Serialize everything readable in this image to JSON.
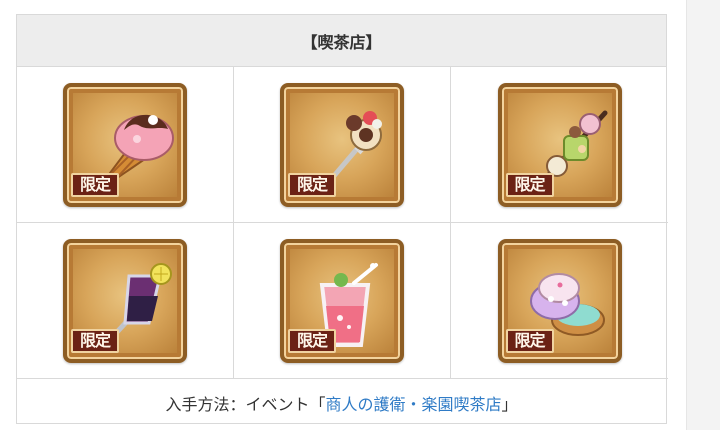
{
  "table": {
    "title": "【喫茶店】",
    "badge_label": "限定",
    "items": [
      {
        "icon": "ice-cream-cone-icon"
      },
      {
        "icon": "fork-with-dessert-icon"
      },
      {
        "icon": "skewer-sweets-icon"
      },
      {
        "icon": "fruit-parfait-icon"
      },
      {
        "icon": "pink-drink-icon"
      },
      {
        "icon": "decorated-cookies-icon"
      }
    ],
    "footer": {
      "prefix": "入手方法：イベント「",
      "link_text": "商人の護衛・楽園喫茶店",
      "suffix": "」"
    }
  }
}
